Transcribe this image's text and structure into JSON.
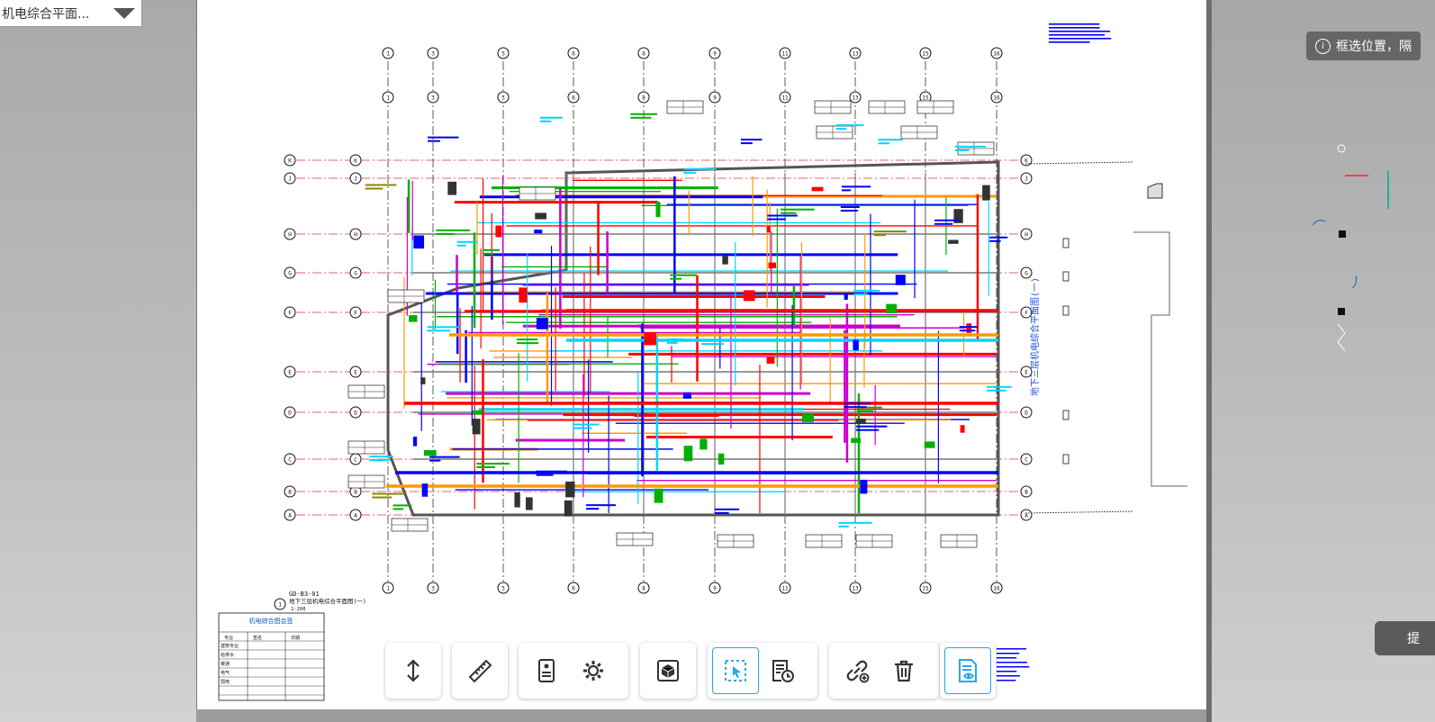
{
  "drawing_selector": {
    "value": "机电综合平面..."
  },
  "hint": {
    "text": "框选位置，隔"
  },
  "side_button": {
    "label": "提"
  },
  "plan": {
    "code": "GD-B3-01",
    "title": "地下三层机电综合平面图(一)",
    "scale": "1:200",
    "view_number": "1",
    "vertical_title": "地下三层机电综合平面图(一)"
  },
  "grid_columns": [
    "1",
    "3",
    "5",
    "6",
    "8",
    "9",
    "11",
    "13",
    "15",
    "16"
  ],
  "grid_rows": [
    "K",
    "J",
    "H",
    "G",
    "F",
    "E",
    "D",
    "C",
    "B",
    "A"
  ],
  "legend_table": {
    "title": "机电综合图会签",
    "headers": [
      "专业",
      "签名",
      "日期"
    ],
    "rows": [
      "建筑专业",
      "给排水",
      "暖通",
      "电气",
      "弱电"
    ]
  },
  "colors": {
    "pipe_red": "#ff0000",
    "pipe_orange": "#ff9900",
    "pipe_blue": "#0000ff",
    "pipe_green": "#00b000",
    "pipe_cyan": "#00d5ff",
    "pipe_magenta": "#cc00cc",
    "accent": "#22a7f0"
  },
  "toolbar": [
    {
      "name": "elevation-icon",
      "group": 1
    },
    {
      "name": "measure-ruler-icon",
      "group": 2
    },
    {
      "name": "properties-panel-icon",
      "group": 3
    },
    {
      "name": "settings-gear-icon",
      "group": 3
    },
    {
      "name": "model-3d-cube-icon",
      "group": 4
    },
    {
      "name": "box-select-icon",
      "group": 5,
      "active": true
    },
    {
      "name": "history-record-icon",
      "group": 5
    },
    {
      "name": "add-link-icon",
      "group": 6
    },
    {
      "name": "delete-trash-icon",
      "group": 6
    },
    {
      "name": "view-document-icon",
      "group": 7,
      "active": true
    }
  ]
}
